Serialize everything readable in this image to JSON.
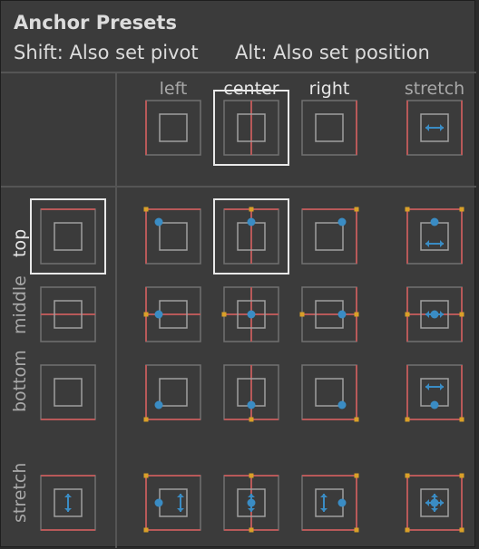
{
  "header": {
    "title": "Anchor Presets",
    "shift_hint": "Shift: Also set pivot",
    "alt_hint": "Alt: Also set position"
  },
  "columns": [
    {
      "id": "left",
      "label": "left"
    },
    {
      "id": "center",
      "label": "center"
    },
    {
      "id": "right",
      "label": "right"
    },
    {
      "id": "stretch",
      "label": "stretch"
    }
  ],
  "rows": [
    {
      "id": "top",
      "label": "top"
    },
    {
      "id": "middle",
      "label": "middle"
    },
    {
      "id": "bottom",
      "label": "bottom"
    },
    {
      "id": "stretch",
      "label": "stretch"
    }
  ],
  "selected": {
    "column": "center",
    "row": "top"
  },
  "colors": {
    "panel_bg": "#3b3b3b",
    "divider": "#555555",
    "outer_rect": "#717171",
    "inner_rect": "#a0a0a0",
    "anchor_line": "#b85959",
    "anchor_marker": "#d9a028",
    "pivot": "#3a8cc4",
    "selected_border": "#e8e8e8"
  }
}
